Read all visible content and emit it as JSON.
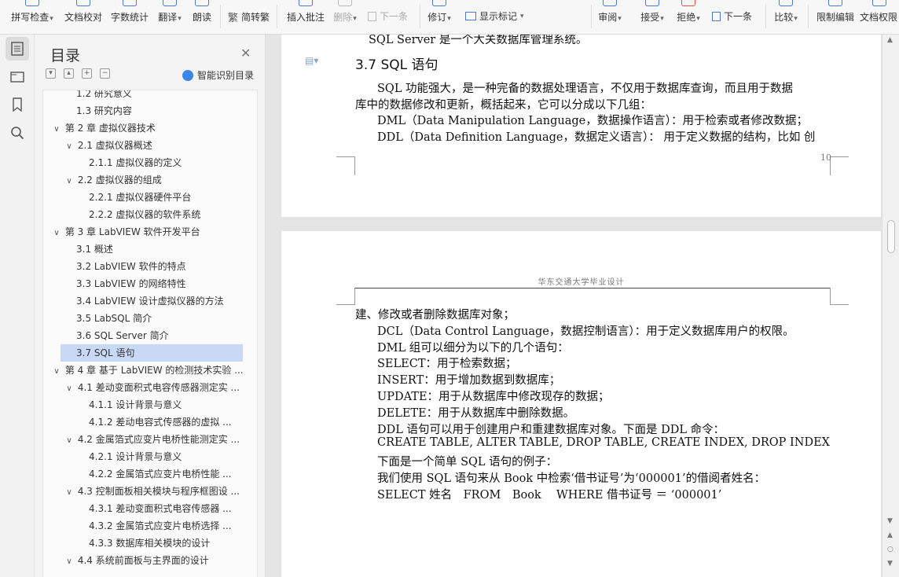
{
  "ribbon": {
    "spell_check": "拼写检查",
    "doc_proof": "文档校对",
    "word_count": "字数统计",
    "translate": "翻译",
    "read_aloud": "朗读",
    "simp_trad": "简转繁",
    "insert_comment": "插入批注",
    "delete": "删除",
    "next": "下一条",
    "revise": "修订",
    "show_marks": "显示标记",
    "review": "审阅",
    "accept": "接受",
    "reject": "拒绝",
    "next2": "下一条",
    "compare": "比较",
    "restrict_edit": "限制编辑",
    "doc_rights": "文档权限"
  },
  "toc": {
    "title": "目录",
    "smart_label": "智能识别目录",
    "items": [
      {
        "label": "1.2 研究意义",
        "level": 2
      },
      {
        "label": "1.3 研究内容",
        "level": 2
      },
      {
        "label": "第 2 章 虚拟仪器技术",
        "level": 1
      },
      {
        "label": "2.1 虚拟仪器概述",
        "level": 2
      },
      {
        "label": "2.1.1 虚拟仪器的定义",
        "level": 3
      },
      {
        "label": "2.2 虚拟仪器的组成",
        "level": 2
      },
      {
        "label": "2.2.1 虚拟仪器硬件平台",
        "level": 3
      },
      {
        "label": "2.2.2 虚拟仪器的软件系统",
        "level": 3
      },
      {
        "label": "第 3 章 LabVIEW 软件开发平台",
        "level": 1
      },
      {
        "label": "3.1 概述",
        "level": 2
      },
      {
        "label": "3.2 LabVIEW 软件的特点",
        "level": 2
      },
      {
        "label": "3.3 LabVIEW 的网络特性",
        "level": 2
      },
      {
        "label": "3.4 LabVIEW 设计虚拟仪器的方法",
        "level": 2
      },
      {
        "label": "3.5 LabSQL 简介",
        "level": 2
      },
      {
        "label": "3.6 SQL Server 简介",
        "level": 2
      },
      {
        "label": "3.7 SQL 语句",
        "level": 2
      },
      {
        "label": "第 4 章 基于 LabVIEW 的检测技术实验 ...",
        "level": 1
      },
      {
        "label": "4.1 差动变面积式电容传感器测定实 ...",
        "level": 2
      },
      {
        "label": "4.1.1 设计背景与意义",
        "level": 3
      },
      {
        "label": "4.1.2 差动电容式传感器的虚拟 ...",
        "level": 3
      },
      {
        "label": "4.2 金属箔式应变片电桥性能测定实 ...",
        "level": 2
      },
      {
        "label": "4.2.1 设计背景与意义",
        "level": 3
      },
      {
        "label": "4.2.2 金属箔式应变片电桥性能 ...",
        "level": 3
      },
      {
        "label": "4.3 控制面板相关模块与程序框图设 ...",
        "level": 2
      },
      {
        "label": "4.3.1 差动变面积式电容传感器 ...",
        "level": 3
      },
      {
        "label": "4.3.2 金属箔式应变片电桥选择 ...",
        "level": 3
      },
      {
        "label": "4.3.3 数据库相关模块的设计",
        "level": 3
      },
      {
        "label": "4.4 系统前面板与主界面的设计",
        "level": 2
      }
    ]
  },
  "doc": {
    "page1": {
      "top_line": "SQL Server 是一个大关数据库管理系统。",
      "heading": "3.7 SQL 语句",
      "p1_line1": "SQL 功能强大，是一种完备的数据处理语言，不仅用于数据库查询，而且用于数据",
      "p1_line2": "库中的数据修改和更新，概括起来，它可以分成以下几组：",
      "dml": "DML（Data Manipulation Language，数据操作语言）：用于检索或者修改数据；",
      "ddl": "DDL（Data Definition Language，数据定义语言）： 用于定义数据的结构，比如 创",
      "page_number": "10"
    },
    "page2": {
      "header": "华东交通大学毕业设计",
      "lines": [
        "建、修改或者删除数据库对象；",
        "DCL（Data Control Language，数据控制语言）：用于定义数据库用户的权限。",
        "DML 组可以细分为以下的几个语句：",
        "SELECT：用于检索数据；",
        "INSERT：用于增加数据到数据库；",
        "UPDATE：用于从数据库中修改现存的数据；",
        "DELETE：用于从数据库中删除数据。",
        "DDL 语句可以用于创建用户和重建数据库对象。下面是 DDL 命令：",
        "CREATE TABLE, ALTER TABLE, DROP TABLE, CREATE INDEX, DROP INDEX",
        "下面是一个简单 SQL 语句的例子：",
        "我们使用 SQL 语句来从 Book 中检索‘借书证号’为‘000001’的借阅者姓名：",
        "SELECT 姓名　FROM　Book　 WHERE 借书证号 ＝ ‘000001’"
      ]
    }
  }
}
